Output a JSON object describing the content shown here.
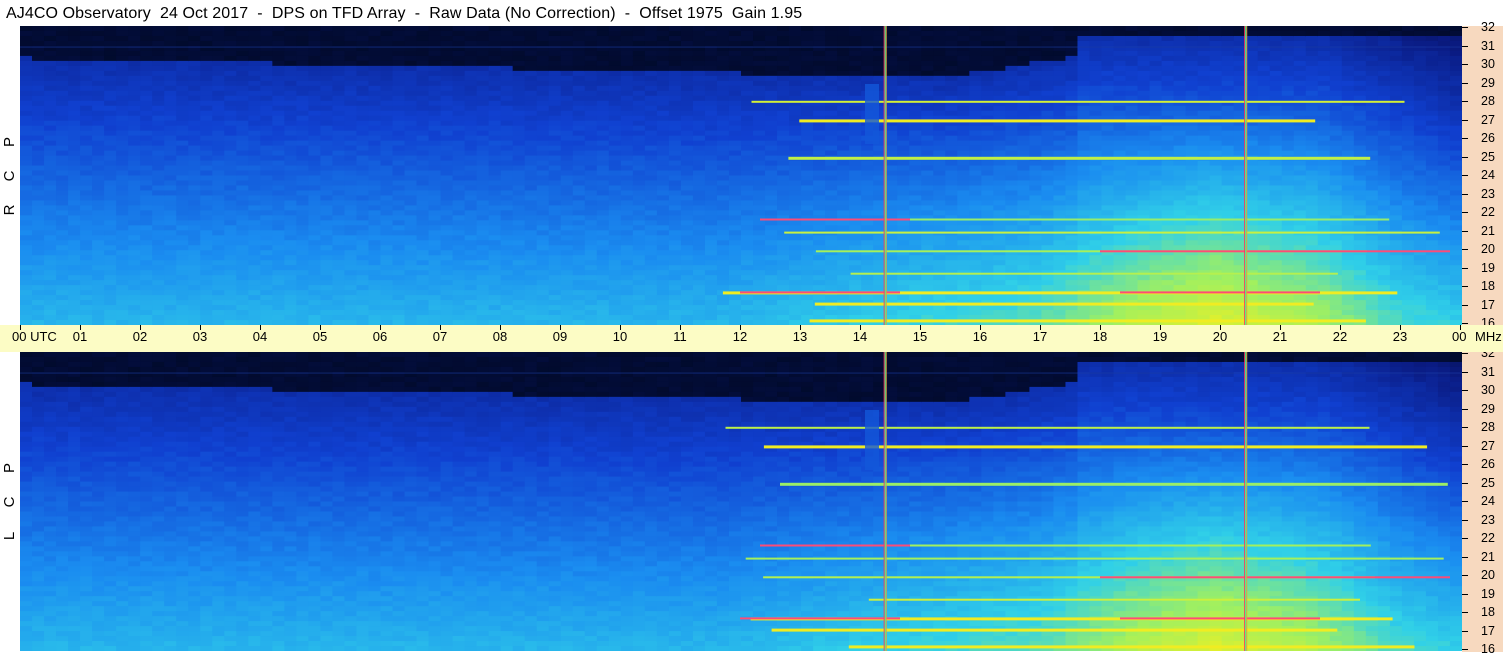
{
  "header": {
    "title": "AJ4CO Observatory  24 Oct 2017  -  DPS on TFD Array  -  Raw Data (No Correction)  -  Offset 1975  Gain 1.95"
  },
  "panels": [
    {
      "id": "top",
      "label_letters": [
        "R",
        "C",
        "P"
      ]
    },
    {
      "id": "bottom",
      "label_letters": [
        "L",
        "C",
        "P"
      ]
    }
  ],
  "time_axis": {
    "labels": [
      "00 UTC",
      "01",
      "02",
      "03",
      "04",
      "05",
      "06",
      "07",
      "08",
      "09",
      "10",
      "11",
      "12",
      "13",
      "14",
      "15",
      "16",
      "17",
      "18",
      "19",
      "20",
      "21",
      "22",
      "23",
      "00"
    ]
  },
  "freq_axis": {
    "unit": "MHz",
    "labels": [
      "32",
      "31",
      "30",
      "29",
      "28",
      "27",
      "26",
      "25",
      "24",
      "23",
      "22",
      "21",
      "20",
      "19",
      "18",
      "17",
      "16"
    ]
  },
  "chart_data": {
    "type": "heatmap",
    "title": "AJ4CO Observatory  24 Oct 2017  -  DPS on TFD Array  -  Raw Data (No Correction)  -  Offset 1975  Gain 1.95",
    "x_axis": {
      "range_utc_hours": [
        0,
        24
      ],
      "unit": "UTC"
    },
    "y_axis": {
      "range_mhz": [
        16,
        32
      ],
      "unit": "MHz"
    },
    "panels": [
      "RCP",
      "LCP"
    ],
    "colormap": [
      "#000820",
      "#0a1a80",
      "#1040d0",
      "#1a8cf0",
      "#30d0e8",
      "#a0f060",
      "#f0f020",
      "#ff2090"
    ],
    "features": [
      {
        "type": "vertical_line",
        "utc": 14.4,
        "color": "#e8a040"
      },
      {
        "type": "vertical_line",
        "utc": 20.4,
        "color": "#e8a040"
      }
    ],
    "grid": false
  }
}
